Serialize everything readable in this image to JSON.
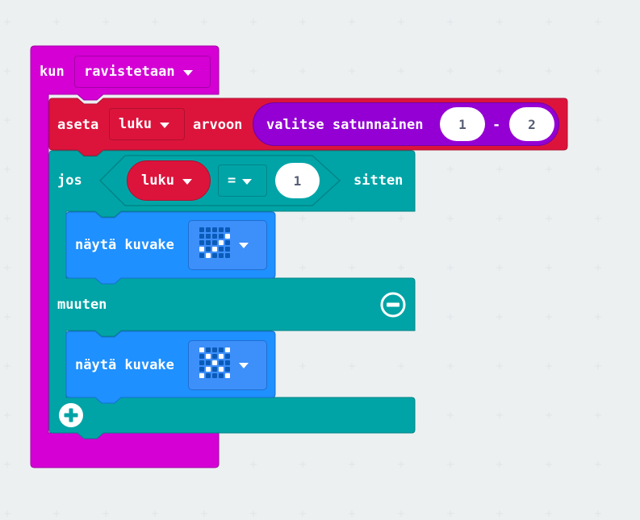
{
  "workspace": {
    "background": "#ecf0f1",
    "grid_color": "#dfe4e6"
  },
  "colors": {
    "event": "#d400d4",
    "event_dark": "#a600a6",
    "variables": "#dc143c",
    "variables_dark": "#b0102f",
    "math": "#9400d3",
    "math_dark": "#7300a6",
    "logic": "#00a4a6",
    "logic_dark": "#008587",
    "basic": "#1e90ff",
    "basic_dark": "#1670cc",
    "led_on": "#ffffff",
    "led_off": "#0a5bb8"
  },
  "event_block": {
    "label": "kun",
    "gesture": "ravistetaan"
  },
  "set_block": {
    "label": "aseta",
    "variable": "luku",
    "to_label": "arvoon"
  },
  "random_block": {
    "label": "valitse satunnainen",
    "min": "1",
    "separator": "-",
    "max": "2"
  },
  "if_block": {
    "if_label": "jos",
    "variable": "luku",
    "operator": "=",
    "value": "1",
    "then_label": "sitten",
    "else_label": "muuten",
    "remove_icon": "minus-circle-icon",
    "add_icon": "plus-circle-icon"
  },
  "show_icon_blocks": [
    {
      "label": "näytä kuvake",
      "icon_name": "check-icon",
      "pattern": [
        [
          0,
          0,
          0,
          0,
          0
        ],
        [
          0,
          0,
          0,
          0,
          1
        ],
        [
          0,
          0,
          0,
          1,
          0
        ],
        [
          1,
          0,
          1,
          0,
          0
        ],
        [
          0,
          1,
          0,
          0,
          0
        ]
      ]
    },
    {
      "label": "näytä kuvake",
      "icon_name": "cross-icon",
      "pattern": [
        [
          1,
          0,
          0,
          0,
          1
        ],
        [
          0,
          1,
          0,
          1,
          0
        ],
        [
          0,
          0,
          1,
          0,
          0
        ],
        [
          0,
          1,
          0,
          1,
          0
        ],
        [
          1,
          0,
          0,
          0,
          1
        ]
      ]
    }
  ]
}
